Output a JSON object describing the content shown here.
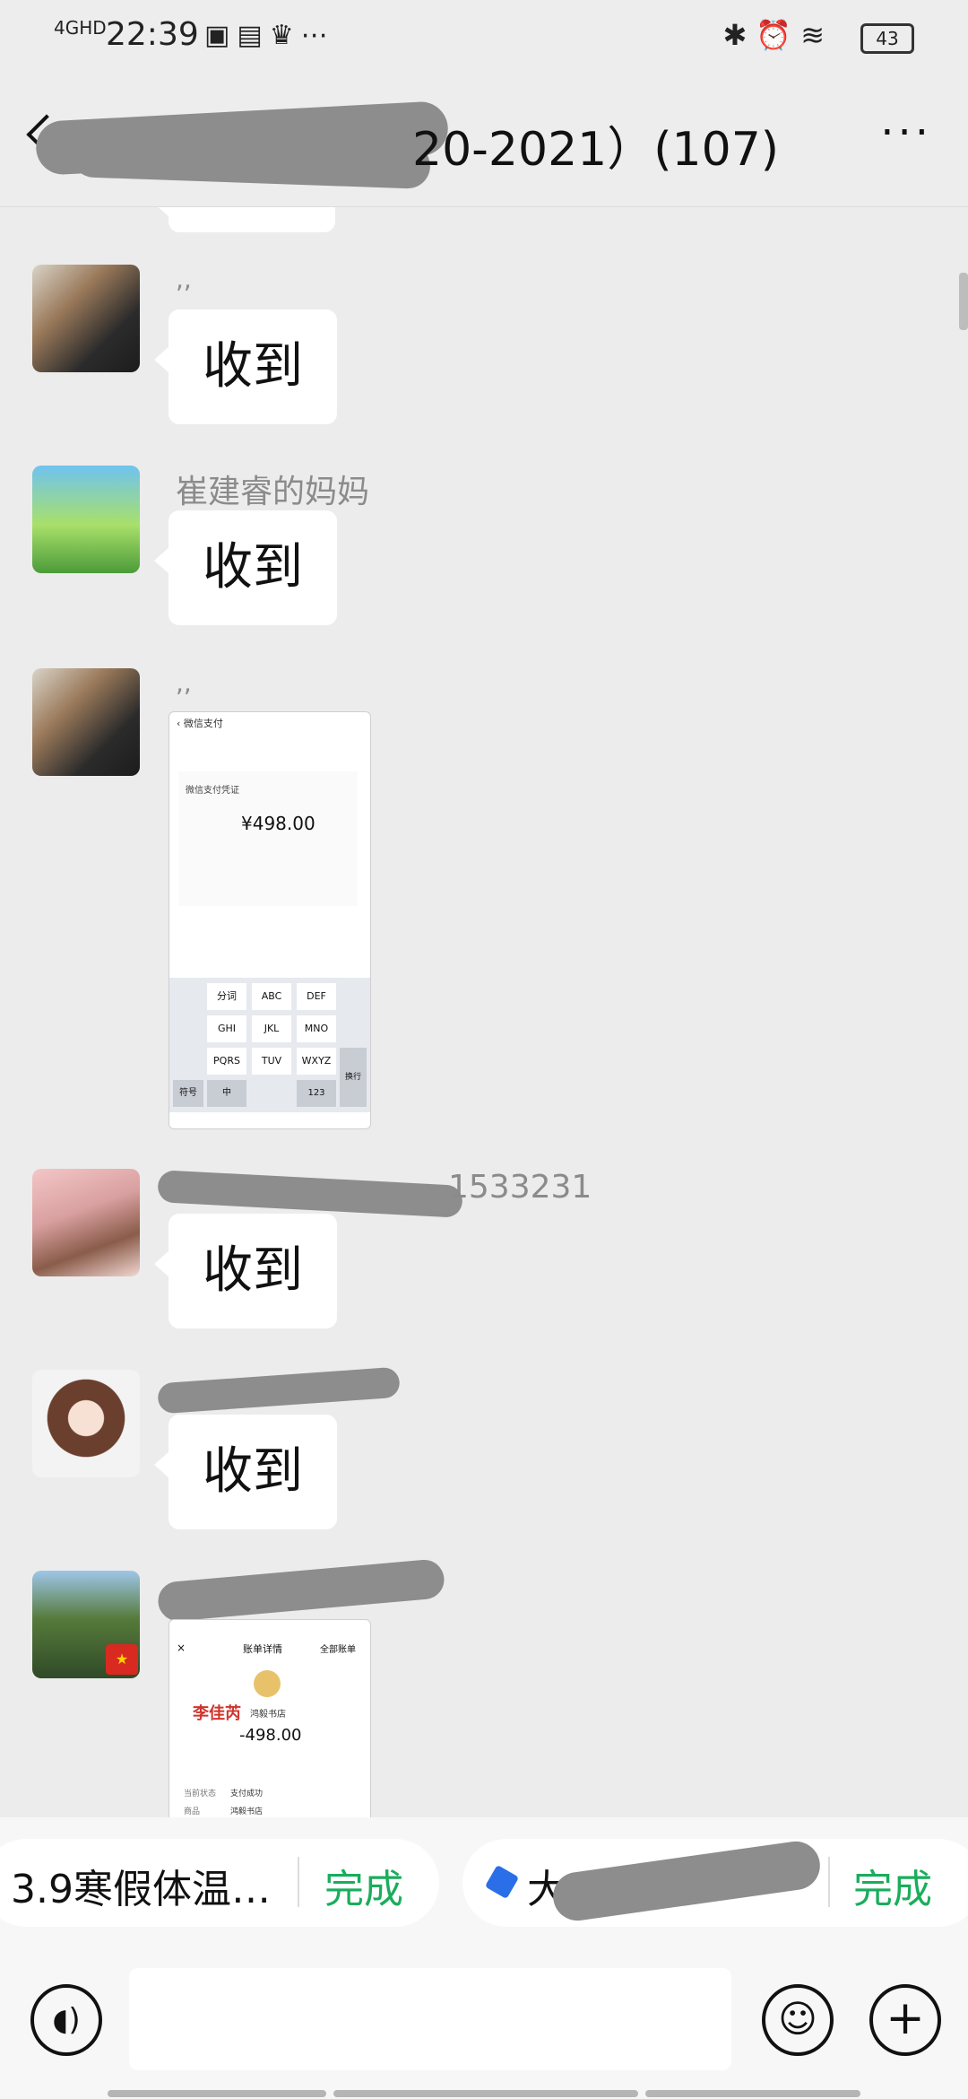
{
  "status_bar": {
    "network": "4GHD",
    "time": "22:39",
    "left_icons": [
      "app-icon-tuan",
      "alipay-icon",
      "crown-icon",
      "more-dots-icon"
    ],
    "right_icons": [
      "bluetooth-icon",
      "alarm-icon",
      "wifi-icon"
    ],
    "battery": "43"
  },
  "navbar": {
    "title_visible": "20-2021）(107)",
    "more_label": "···"
  },
  "messages": [
    {
      "sender": "",
      "bubble": "收到"
    },
    {
      "sender": "崔建睿的妈妈",
      "bubble": "收到"
    },
    {
      "sender": "",
      "screenshot": {
        "header": "微信支付",
        "section": "微信支付凭证",
        "amount": "¥498.00",
        "keys": [
          "分词",
          "ABC",
          "DEF",
          "GHI",
          "JKL",
          "MNO",
          "PQRS",
          "TUV",
          "WXYZ"
        ],
        "bottom_keys": [
          "符号",
          "中",
          "123",
          "换行"
        ]
      }
    },
    {
      "sender_visible": "1533231",
      "bubble": "收到"
    },
    {
      "sender": "",
      "bubble": "收到"
    },
    {
      "sender": "",
      "screenshot": {
        "header_left": "×",
        "header_mid": "账单详情",
        "header_right": "全部账单",
        "name": "李佳芮",
        "shop": "鸿毅书店",
        "amount": "-498.00",
        "row1_label": "当前状态",
        "row1_value": "支付成功",
        "row2_label": "商品",
        "row2_value": "鸿毅书店"
      }
    }
  ],
  "pending_bar": {
    "chip1_text": "3.9寒假体温…",
    "chip1_action": "完成",
    "chip2_text": "大",
    "chip2_action": "完成"
  },
  "input_bar": {
    "voice_icon": "voice-icon",
    "emoji_icon": "emoji-icon",
    "plus_icon": "plus-icon"
  },
  "colors": {
    "background": "#ececec",
    "bubble": "#ffffff",
    "accent_green": "#1aad5c",
    "sender_gray": "#8b8b8b"
  }
}
